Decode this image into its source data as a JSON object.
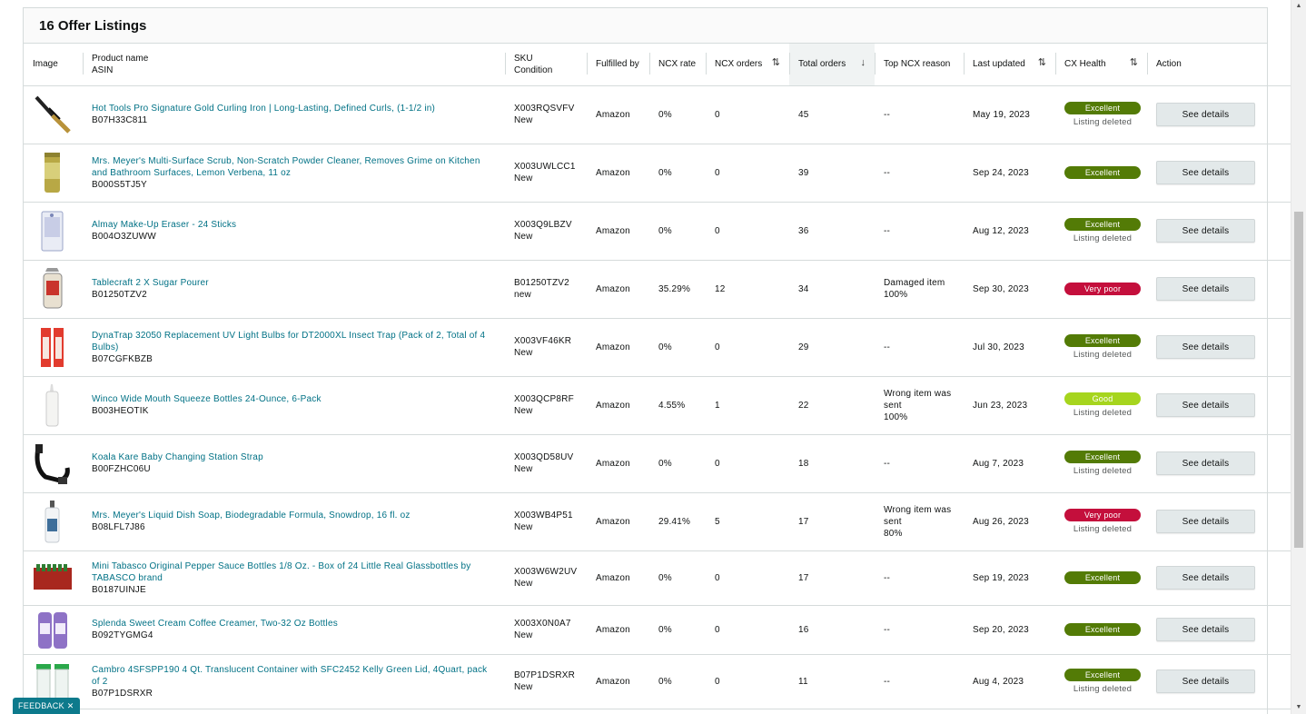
{
  "listings_title": "16 Offer Listings",
  "columns": {
    "image": "Image",
    "product_name": "Product name",
    "asin": "ASIN",
    "sku": "SKU",
    "condition": "Condition",
    "fulfilled_by": "Fulfilled by",
    "ncx_rate": "NCX rate",
    "ncx_orders": "NCX orders",
    "total_orders": "Total orders",
    "top_ncx_reason": "Top NCX reason",
    "last_updated": "Last updated",
    "cx_health": "CX Health",
    "action": "Action"
  },
  "icons": {
    "sort": "sort-both-icon",
    "sorted_desc": "arrow-down-icon"
  },
  "colors": {
    "link": "#007185",
    "excellent": "#537b06",
    "good": "#a6d51e",
    "very_poor": "#c40f3c",
    "feedback": "#0d7a8c"
  },
  "rows": [
    {
      "image": "curling-iron",
      "name": "Hot Tools Pro Signature Gold Curling Iron | Long-Lasting, Defined Curls, (1-1/2 in)",
      "asin": "B07H33C811",
      "sku": "X003RQSVFV",
      "condition": "New",
      "fulfilled": "Amazon",
      "ncx_rate": "0%",
      "ncx_orders": "0",
      "total_orders": "45",
      "reason": "--",
      "reason_pct": "",
      "updated": "May 19, 2023",
      "health": "Excellent",
      "health_class": "excellent",
      "deleted": "Listing deleted",
      "action": "See details"
    },
    {
      "image": "powder-cleaner",
      "name": "Mrs. Meyer's Multi-Surface Scrub, Non-Scratch Powder Cleaner, Removes Grime on Kitchen and Bathroom Surfaces, Lemon Verbena, 11 oz",
      "asin": "B000S5TJ5Y",
      "sku": "X003UWLCC1",
      "condition": "New",
      "fulfilled": "Amazon",
      "ncx_rate": "0%",
      "ncx_orders": "0",
      "total_orders": "39",
      "reason": "--",
      "reason_pct": "",
      "updated": "Sep 24, 2023",
      "health": "Excellent",
      "health_class": "excellent",
      "deleted": "",
      "action": "See details"
    },
    {
      "image": "makeup-eraser",
      "name": "Almay Make-Up Eraser - 24 Sticks",
      "asin": "B004O3ZUWW",
      "sku": "X003Q9LBZV",
      "condition": "New",
      "fulfilled": "Amazon",
      "ncx_rate": "0%",
      "ncx_orders": "0",
      "total_orders": "36",
      "reason": "--",
      "reason_pct": "",
      "updated": "Aug 12, 2023",
      "health": "Excellent",
      "health_class": "excellent",
      "deleted": "Listing deleted",
      "action": "See details"
    },
    {
      "image": "sugar-pourer",
      "name": "Tablecraft 2 X Sugar Pourer",
      "asin": "B01250TZV2",
      "sku": "B01250TZV2",
      "condition": "new",
      "fulfilled": "Amazon",
      "ncx_rate": "35.29%",
      "ncx_orders": "12",
      "total_orders": "34",
      "reason": "Damaged item",
      "reason_pct": "100%",
      "updated": "Sep 30, 2023",
      "health": "Very poor",
      "health_class": "poor",
      "deleted": "",
      "action": "See details"
    },
    {
      "image": "uv-bulbs",
      "name": "DynaTrap 32050 Replacement UV Light Bulbs for DT2000XL Insect Trap (Pack of 2, Total of 4 Bulbs)",
      "asin": "B07CGFKBZB",
      "sku": "X003VF46KR",
      "condition": "New",
      "fulfilled": "Amazon",
      "ncx_rate": "0%",
      "ncx_orders": "0",
      "total_orders": "29",
      "reason": "--",
      "reason_pct": "",
      "updated": "Jul 30, 2023",
      "health": "Excellent",
      "health_class": "excellent",
      "deleted": "Listing deleted",
      "action": "See details"
    },
    {
      "image": "squeeze-bottle",
      "name": "Winco Wide Mouth Squeeze Bottles 24-Ounce, 6-Pack",
      "asin": "B003HEOTIK",
      "sku": "X003QCP8RF",
      "condition": "New",
      "fulfilled": "Amazon",
      "ncx_rate": "4.55%",
      "ncx_orders": "1",
      "total_orders": "22",
      "reason": "Wrong item was sent",
      "reason_pct": "100%",
      "updated": "Jun 23, 2023",
      "health": "Good",
      "health_class": "good",
      "deleted": "Listing deleted",
      "action": "See details"
    },
    {
      "image": "strap",
      "name": "Koala Kare Baby Changing Station Strap",
      "asin": "B00FZHC06U",
      "sku": "X003QD58UV",
      "condition": "New",
      "fulfilled": "Amazon",
      "ncx_rate": "0%",
      "ncx_orders": "0",
      "total_orders": "18",
      "reason": "--",
      "reason_pct": "",
      "updated": "Aug 7, 2023",
      "health": "Excellent",
      "health_class": "excellent",
      "deleted": "Listing deleted",
      "action": "See details"
    },
    {
      "image": "dish-soap",
      "name": "Mrs. Meyer's Liquid Dish Soap, Biodegradable Formula, Snowdrop, 16 fl. oz",
      "asin": "B08LFL7J86",
      "sku": "X003WB4P51",
      "condition": "New",
      "fulfilled": "Amazon",
      "ncx_rate": "29.41%",
      "ncx_orders": "5",
      "total_orders": "17",
      "reason": "Wrong item was sent",
      "reason_pct": "80%",
      "updated": "Aug 26, 2023",
      "health": "Very poor",
      "health_class": "poor",
      "deleted": "Listing deleted",
      "action": "See details"
    },
    {
      "image": "tabasco",
      "name": "Mini Tabasco Original Pepper Sauce Bottles 1/8 Oz. - Box of 24 Little Real Glassbottles by TABASCO brand",
      "asin": "B0187UINJE",
      "sku": "X003W6W2UV",
      "condition": "New",
      "fulfilled": "Amazon",
      "ncx_rate": "0%",
      "ncx_orders": "0",
      "total_orders": "17",
      "reason": "--",
      "reason_pct": "",
      "updated": "Sep 19, 2023",
      "health": "Excellent",
      "health_class": "excellent",
      "deleted": "",
      "action": "See details"
    },
    {
      "image": "creamer",
      "name": "Splenda Sweet Cream Coffee Creamer, Two-32 Oz Bottles",
      "asin": "B092TYGMG4",
      "sku": "X003X0N0A7",
      "condition": "New",
      "fulfilled": "Amazon",
      "ncx_rate": "0%",
      "ncx_orders": "0",
      "total_orders": "16",
      "reason": "--",
      "reason_pct": "",
      "updated": "Sep 20, 2023",
      "health": "Excellent",
      "health_class": "excellent",
      "deleted": "",
      "action": "See details"
    },
    {
      "image": "container",
      "name": "Cambro 4SFSPP190 4 Qt. Translucent Container with SFC2452 Kelly Green Lid, 4Quart, pack of 2",
      "asin": "B07P1DSRXR",
      "sku": "B07P1DSRXR",
      "condition": "New",
      "fulfilled": "Amazon",
      "ncx_rate": "0%",
      "ncx_orders": "0",
      "total_orders": "11",
      "reason": "--",
      "reason_pct": "",
      "updated": "Aug 4, 2023",
      "health": "Excellent",
      "health_class": "excellent",
      "deleted": "Listing deleted",
      "action": "See details"
    }
  ],
  "feedback_label": "FEEDBACK ✕",
  "scroll_up_icon": "▲",
  "scroll_down_icon": "▼"
}
